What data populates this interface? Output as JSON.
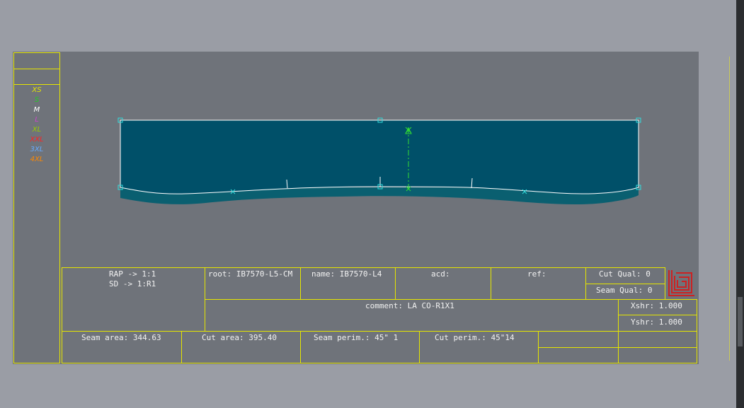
{
  "sizes": [
    {
      "label": "XS",
      "color": "#e6e600"
    },
    {
      "label": "S",
      "color": "#22cc22"
    },
    {
      "label": "M",
      "color": "#ffffff"
    },
    {
      "label": "L",
      "color": "#cc44cc"
    },
    {
      "label": "XL",
      "color": "#99cc00"
    },
    {
      "label": "XXL",
      "color": "#ff2222"
    },
    {
      "label": "3XL",
      "color": "#66aaff"
    },
    {
      "label": "4XL",
      "color": "#ff8800"
    }
  ],
  "info": {
    "rap": "RAP -> 1:1",
    "sd": "SD -> 1:R1",
    "root": "root: IB7570-L5-CM",
    "name": "name: IB7570-L4",
    "acd": "acd:",
    "ref": "ref:",
    "cut_qual": "Cut Qual: 0",
    "seam_qual": "Seam Qual: 0",
    "comment": "comment: LA CO-R1X1",
    "xshr": "Xshr: 1.000",
    "yshr": "Yshr: 1.000",
    "seam_area": "Seam area: 344.63",
    "cut_area": "Cut area: 395.40",
    "seam_perim": "Seam perim.:  45\" 1",
    "cut_perim": "Cut perim.:  45\"14"
  },
  "colors": {
    "piece_fill": "#005069",
    "piece_shadow": "#0a5f70",
    "outline": "#ffffff",
    "handle": "#33dddd",
    "grain": "#33dd33",
    "frame": "#e6e600",
    "logo": "#cc2222"
  },
  "icons": {
    "logo": "brand-logo-icon"
  }
}
